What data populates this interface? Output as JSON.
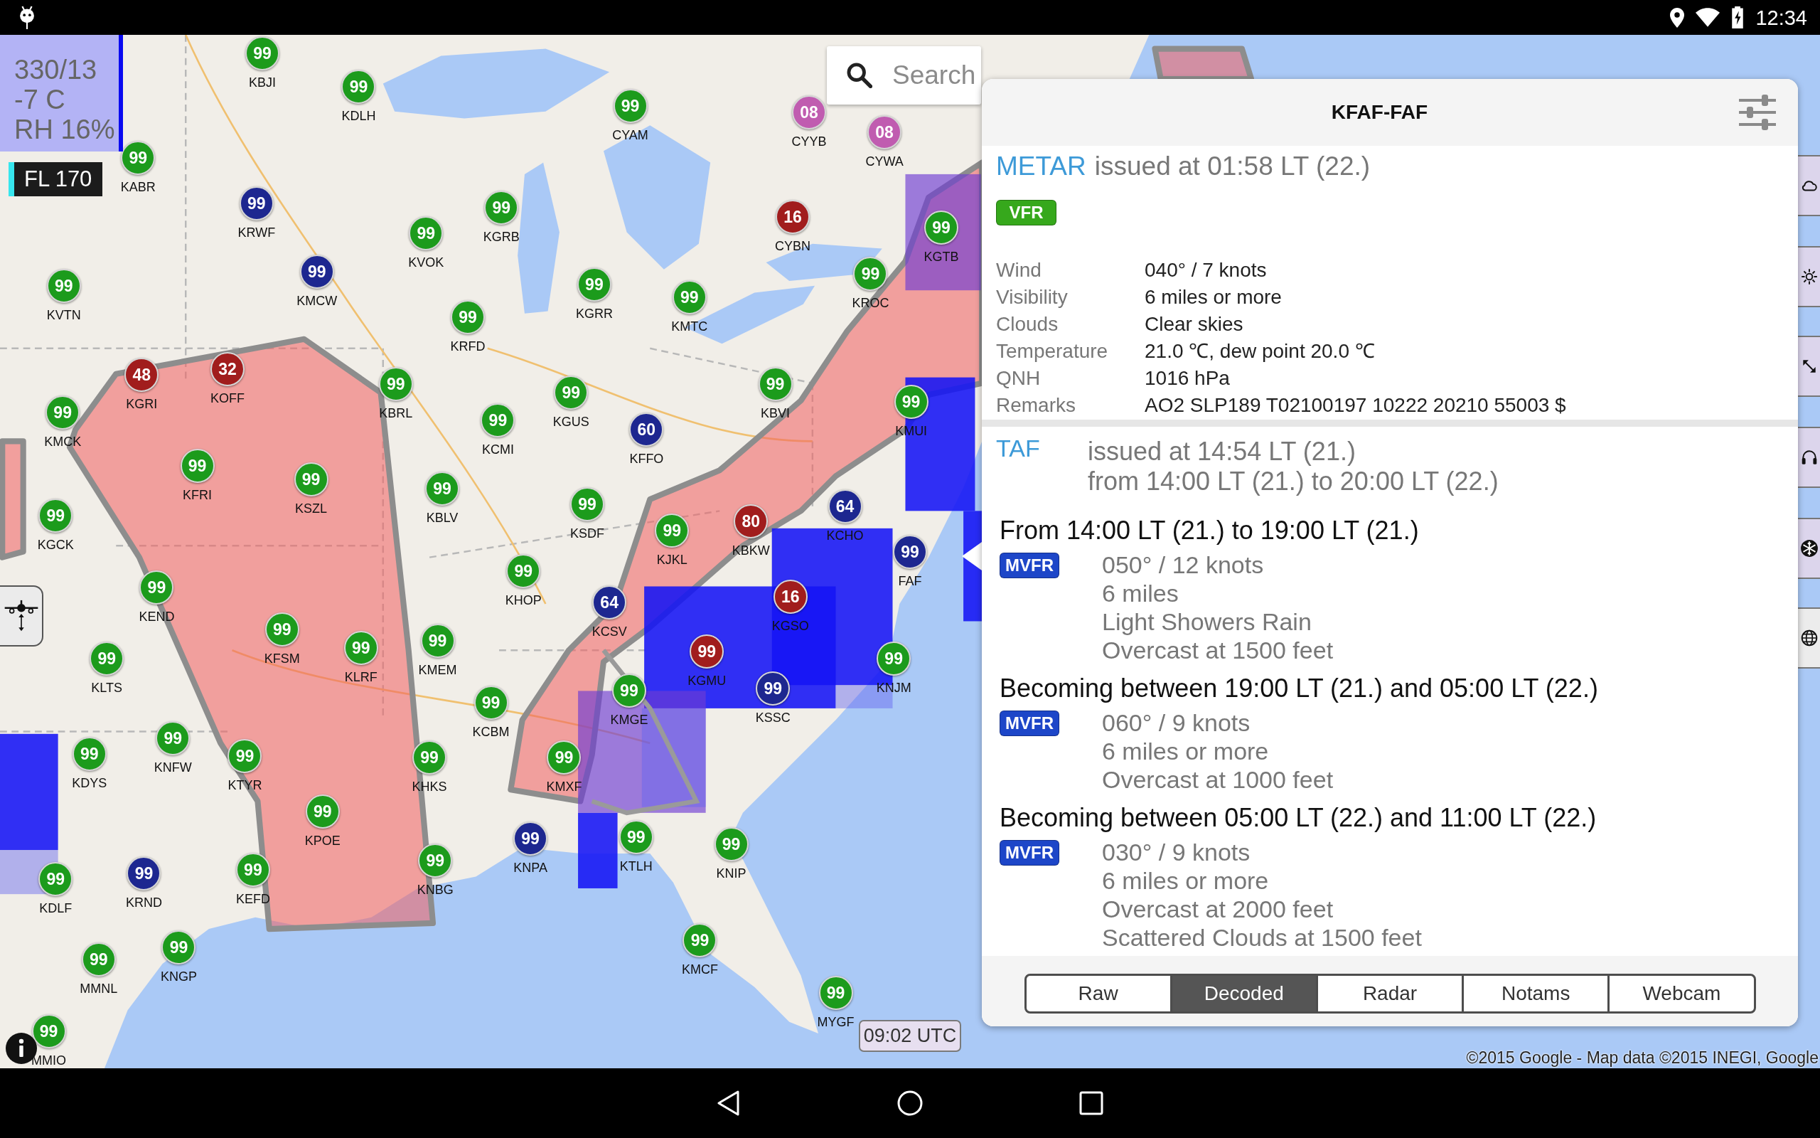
{
  "status_bar": {
    "time": "12:34"
  },
  "map": {
    "search": {
      "placeholder": "Search"
    },
    "winds_aloft": {
      "wind": "330/13",
      "temperature": "-7 C",
      "humidity": "RH 16%"
    },
    "flight_level": "FL 170",
    "stations": [
      {
        "value": "99",
        "code": "KBJI",
        "color": "#1c9b1c"
      },
      {
        "value": "99",
        "code": "KDLH",
        "color": "#1c9b1c"
      },
      {
        "value": "99",
        "code": "CYAM",
        "color": "#1c9b1c"
      },
      {
        "value": "08",
        "code": "CYYB",
        "color": "#c05cb0"
      },
      {
        "value": "08",
        "code": "CYWA",
        "color": "#c05cb0"
      },
      {
        "value": "99",
        "code": "KABR",
        "color": "#1c9b1c"
      },
      {
        "value": "99",
        "code": "KRWF",
        "color": "#1d2790"
      },
      {
        "value": "99",
        "code": "KGRB",
        "color": "#1c9b1c"
      },
      {
        "value": "16",
        "code": "CYBN",
        "color": "#a11d1d"
      },
      {
        "value": "99",
        "code": "KVOK",
        "color": "#1c9b1c"
      },
      {
        "value": "99",
        "code": "KGTB",
        "color": "#1c9b1c"
      },
      {
        "value": "99",
        "code": "KVTN",
        "color": "#1c9b1c"
      },
      {
        "value": "99",
        "code": "KMCW",
        "color": "#1d2790"
      },
      {
        "value": "99",
        "code": "KGRR",
        "color": "#1c9b1c"
      },
      {
        "value": "99",
        "code": "KROC",
        "color": "#1c9b1c"
      },
      {
        "value": "99",
        "code": "KMTC",
        "color": "#1c9b1c"
      },
      {
        "value": "99",
        "code": "KRFD",
        "color": "#1c9b1c"
      },
      {
        "value": "48",
        "code": "KGRI",
        "color": "#a11d1d"
      },
      {
        "value": "32",
        "code": "KOFF",
        "color": "#a11d1d"
      },
      {
        "value": "99",
        "code": "KBRL",
        "color": "#1c9b1c"
      },
      {
        "value": "99",
        "code": "KGUS",
        "color": "#1c9b1c"
      },
      {
        "value": "99",
        "code": "KBVI",
        "color": "#1c9b1c"
      },
      {
        "value": "99",
        "code": "KMCK",
        "color": "#1c9b1c"
      },
      {
        "value": "99",
        "code": "KMUI",
        "color": "#1c9b1c"
      },
      {
        "value": "99",
        "code": "KCMI",
        "color": "#1c9b1c"
      },
      {
        "value": "60",
        "code": "KFFO",
        "color": "#1d2790"
      },
      {
        "value": "99",
        "code": "KFRI",
        "color": "#1c9b1c"
      },
      {
        "value": "99",
        "code": "KSZL",
        "color": "#1c9b1c"
      },
      {
        "value": "99",
        "code": "KBLV",
        "color": "#1c9b1c"
      },
      {
        "value": "99",
        "code": "KGCK",
        "color": "#1c9b1c"
      },
      {
        "value": "99",
        "code": "KSDF",
        "color": "#1c9b1c"
      },
      {
        "value": "64",
        "code": "KCHO",
        "color": "#1d2790"
      },
      {
        "value": "99",
        "code": "KJKL",
        "color": "#1c9b1c"
      },
      {
        "value": "80",
        "code": "KBKW",
        "color": "#a11d1d"
      },
      {
        "value": "99",
        "code": "FAF",
        "color": "#1d2790"
      },
      {
        "value": "99",
        "code": "KHOP",
        "color": "#1c9b1c"
      },
      {
        "value": "99",
        "code": "KEND",
        "color": "#1c9b1c"
      },
      {
        "value": "64",
        "code": "KCSV",
        "color": "#1d2790"
      },
      {
        "value": "16",
        "code": "KGSO",
        "color": "#a11d1d"
      },
      {
        "value": "99",
        "code": "KFSM",
        "color": "#1c9b1c"
      },
      {
        "value": "99",
        "code": "KLTS",
        "color": "#1c9b1c"
      },
      {
        "value": "99",
        "code": "KLRF",
        "color": "#1c9b1c"
      },
      {
        "value": "99",
        "code": "KMEM",
        "color": "#1c9b1c"
      },
      {
        "value": "99",
        "code": "KGMU",
        "color": "#a11d1d"
      },
      {
        "value": "99",
        "code": "KNJM",
        "color": "#1c9b1c"
      },
      {
        "value": "99",
        "code": "KCBM",
        "color": "#1c9b1c"
      },
      {
        "value": "99",
        "code": "KMGE",
        "color": "#1c9b1c"
      },
      {
        "value": "99",
        "code": "KSSC",
        "color": "#1d2790"
      },
      {
        "value": "99",
        "code": "KNFW",
        "color": "#1c9b1c"
      },
      {
        "value": "99",
        "code": "KDYS",
        "color": "#1c9b1c"
      },
      {
        "value": "99",
        "code": "KTYR",
        "color": "#1c9b1c"
      },
      {
        "value": "99",
        "code": "KHKS",
        "color": "#1c9b1c"
      },
      {
        "value": "99",
        "code": "KMXF",
        "color": "#1c9b1c"
      },
      {
        "value": "99",
        "code": "KPOE",
        "color": "#1c9b1c"
      },
      {
        "value": "99",
        "code": "KNPA",
        "color": "#1d2790"
      },
      {
        "value": "99",
        "code": "KTLH",
        "color": "#1c9b1c"
      },
      {
        "value": "99",
        "code": "KNIP",
        "color": "#1c9b1c"
      },
      {
        "value": "99",
        "code": "KDLF",
        "color": "#1c9b1c"
      },
      {
        "value": "99",
        "code": "KRND",
        "color": "#1d2790"
      },
      {
        "value": "99",
        "code": "KEFD",
        "color": "#1c9b1c"
      },
      {
        "value": "99",
        "code": "KNBG",
        "color": "#1c9b1c"
      },
      {
        "value": "99",
        "code": "MMNL",
        "color": "#1c9b1c"
      },
      {
        "value": "99",
        "code": "KNGP",
        "color": "#1c9b1c"
      },
      {
        "value": "99",
        "code": "KMCF",
        "color": "#1c9b1c"
      },
      {
        "value": "99",
        "code": "MYGF",
        "color": "#1c9b1c"
      },
      {
        "value": "99",
        "code": "MMIO",
        "color": "#1c9b1c"
      }
    ],
    "time_label": "09:02 UTC",
    "attribution": "©2015 Google - Map data ©2015 INEGI, Google",
    "layer_buttons": [
      {
        "kind": "cloud",
        "on": true
      },
      {
        "kind": "sun",
        "on": true
      },
      {
        "kind": "resize",
        "on": true
      },
      {
        "kind": "headset",
        "on": true
      },
      {
        "kind": "snow",
        "on": true
      },
      {
        "kind": "globe",
        "on": false
      }
    ]
  },
  "station_panel": {
    "title": "KFAF-FAF",
    "metar": {
      "label": "METAR",
      "issued": "issued at 01:58 LT (22.)",
      "category": {
        "text": "VFR",
        "color": "#36a81c"
      },
      "rows": [
        {
          "label": "Wind",
          "value": "040° / 7 knots"
        },
        {
          "label": "Visibility",
          "value": "6 miles or more"
        },
        {
          "label": "Clouds",
          "value": "Clear skies"
        },
        {
          "label": "Temperature",
          "value": "21.0 ℃, dew point 20.0 ℃"
        },
        {
          "label": "QNH",
          "value": "1016 hPa"
        },
        {
          "label": "Remarks",
          "value": "AO2 SLP189 T02100197 10222 20210 55003 $"
        }
      ]
    },
    "taf": {
      "label": "TAF",
      "issued": "issued at 14:54 LT (21.)",
      "validity": "from 14:00 LT (21.) to 20:00 LT (22.)",
      "groups": [
        {
          "heading": "From 14:00 LT (21.) to 19:00 LT (21.)",
          "category": {
            "text": "MVFR",
            "color": "#1d46c8"
          },
          "lines": [
            "050° / 12 knots",
            "6 miles",
            "Light Showers Rain",
            "Overcast at 1500 feet"
          ]
        },
        {
          "heading": "Becoming between 19:00 LT (21.) and 05:00 LT (22.)",
          "category": {
            "text": "MVFR",
            "color": "#1d46c8"
          },
          "lines": [
            "060° / 9 knots",
            "6 miles or more",
            "Overcast at 1000 feet"
          ]
        },
        {
          "heading": "Becoming between 05:00 LT (22.) and 11:00 LT (22.)",
          "category": {
            "text": "MVFR",
            "color": "#1d46c8"
          },
          "lines": [
            "030° / 9 knots",
            "6 miles or more",
            "Overcast at 2000 feet",
            "Scattered Clouds at 1500 feet"
          ]
        }
      ]
    },
    "tabs": [
      {
        "label": "Raw",
        "selected": false
      },
      {
        "label": "Decoded",
        "selected": true
      },
      {
        "label": "Radar",
        "selected": false
      },
      {
        "label": "Notams",
        "selected": false
      },
      {
        "label": "Webcam",
        "selected": false
      }
    ]
  }
}
